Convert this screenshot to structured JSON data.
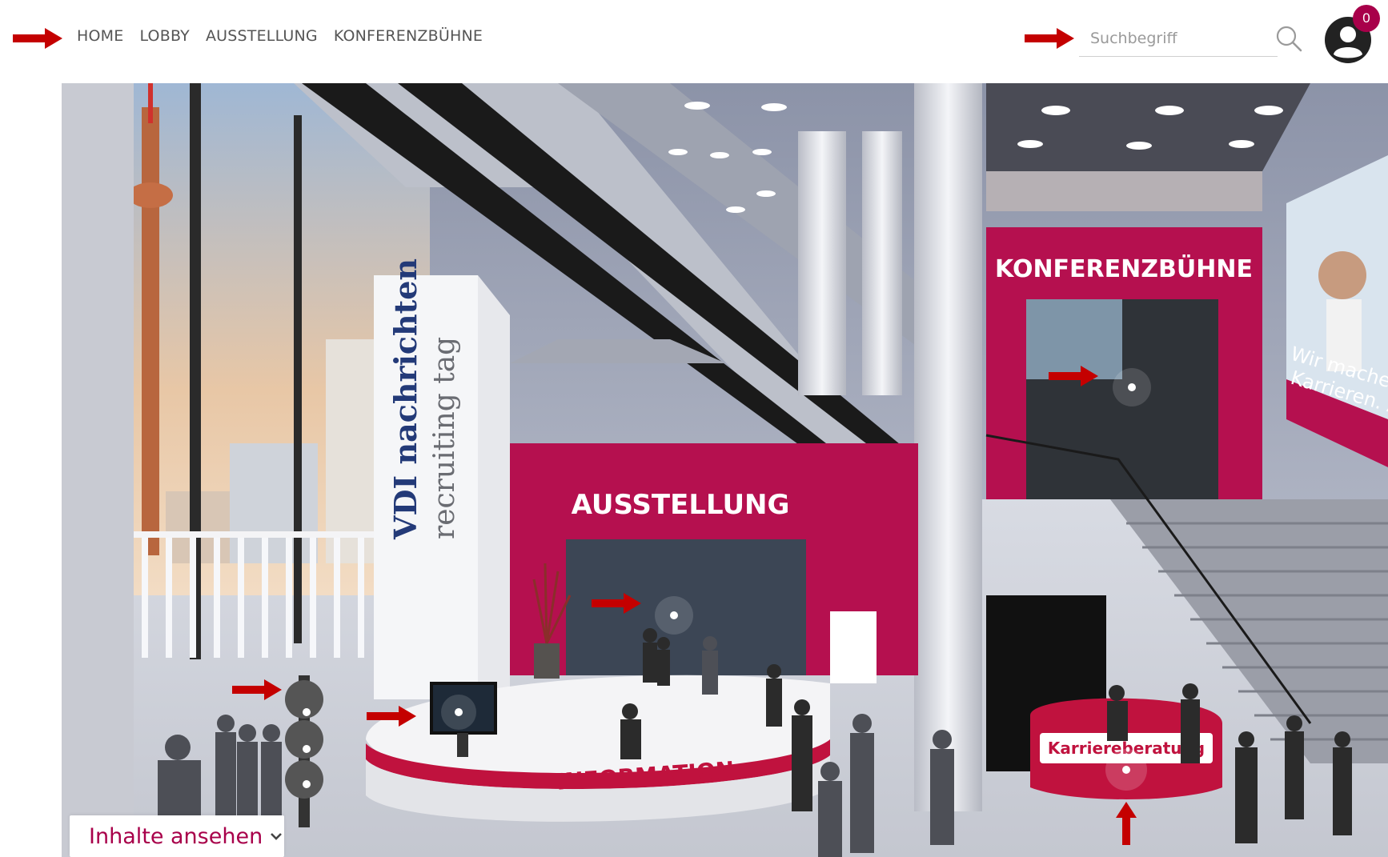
{
  "nav": {
    "items": [
      {
        "label": "HOME"
      },
      {
        "label": "LOBBY"
      },
      {
        "label": "AUSSTELLUNG"
      },
      {
        "label": "KONFERENZBÜHNE"
      }
    ]
  },
  "search": {
    "placeholder": "Suchbegriff",
    "value": ""
  },
  "user": {
    "notification_count": "0"
  },
  "scene": {
    "signs": {
      "konferenz": "KONFERENZBÜHNE",
      "ausstellung": "AUSSTELLUNG",
      "information": "INFORMATION",
      "karriere": "Karriereberatung",
      "pillar_brand": "VDI nachrichten",
      "pillar_sub": "recruiting tag",
      "billboard_1": "Wir machen Inge",
      "billboard_2": "Karrieren. Auch c"
    }
  },
  "contents_button": {
    "label": "Inhalte ansehen"
  },
  "colors": {
    "accent": "#a8004a",
    "arrow": "#c40000",
    "magenta_wall": "#b5104f"
  },
  "icons": [
    "arrow-right-icon",
    "search-icon",
    "user-icon",
    "chevron-down-icon",
    "hotspot-icon",
    "arrow-up-icon"
  ]
}
